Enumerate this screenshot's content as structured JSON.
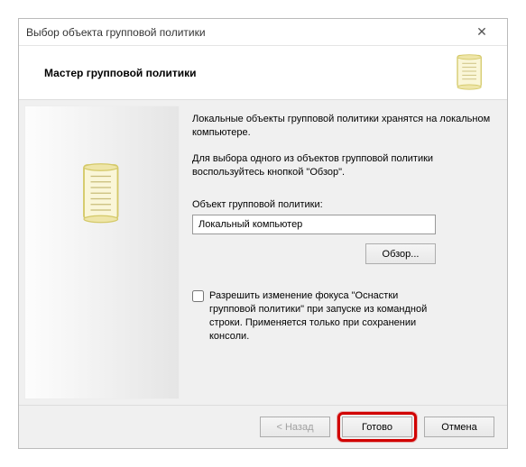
{
  "window": {
    "title": "Выбор объекта групповой политики"
  },
  "header": {
    "title": "Мастер групповой политики"
  },
  "body": {
    "para1": "Локальные объекты групповой политики хранятся на локальном компьютере.",
    "para2": "Для выбора одного из объектов групповой политики воспользуйтесь кнопкой \"Обзор\".",
    "field_label": "Объект групповой политики:",
    "field_value": "Локальный компьютер",
    "browse_label": "Обзор...",
    "checkbox_label": "Разрешить изменение фокуса \"Оснастки групповой политики\" при запуске из командной строки. Применяется только при сохранении консоли."
  },
  "footer": {
    "back": "< Назад",
    "finish": "Готово",
    "cancel": "Отмена"
  }
}
